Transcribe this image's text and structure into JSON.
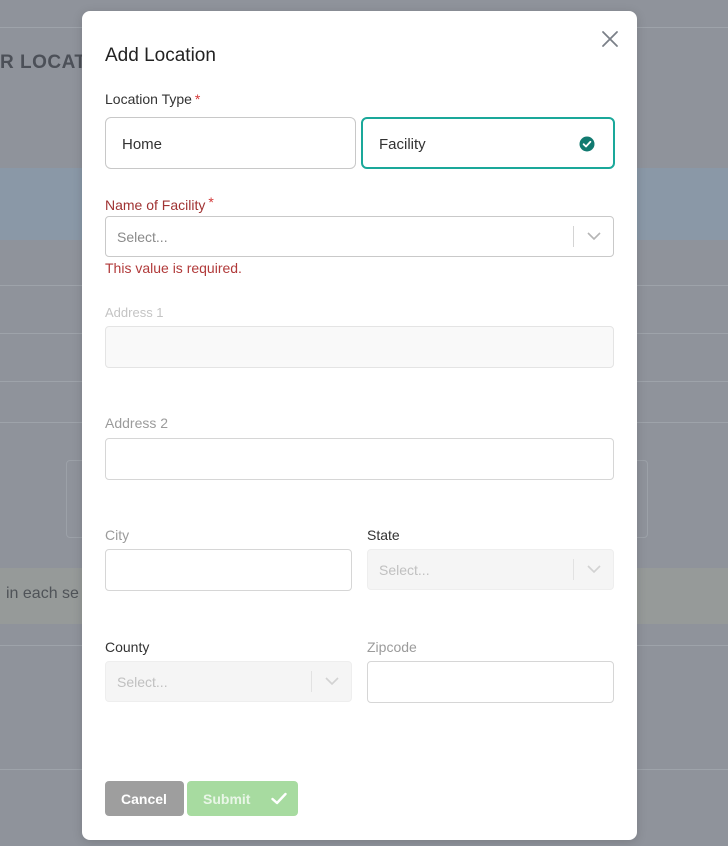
{
  "background": {
    "heading_fragment": "R LOCATIO",
    "banner_fragment": "in each se"
  },
  "modal": {
    "title": "Add Location",
    "close_icon": "close-icon",
    "location_type": {
      "label": "Location Type",
      "required_mark": "*",
      "options": [
        {
          "label": "Home",
          "selected": false
        },
        {
          "label": "Facility",
          "selected": true
        }
      ]
    },
    "facility_name": {
      "label": "Name of Facility",
      "required_mark": "*",
      "placeholder": "Select...",
      "error": "This value is required."
    },
    "address1": {
      "label": "Address 1",
      "value": ""
    },
    "address2": {
      "label": "Address 2",
      "value": ""
    },
    "city": {
      "label": "City",
      "value": ""
    },
    "state": {
      "label": "State",
      "placeholder": "Select..."
    },
    "county": {
      "label": "County",
      "placeholder": "Select..."
    },
    "zipcode": {
      "label": "Zipcode",
      "value": ""
    },
    "buttons": {
      "cancel": "Cancel",
      "submit": "Submit"
    }
  },
  "colors": {
    "accent": "#1aa89a",
    "error": "#a03333",
    "submit_disabled": "#a7dba0",
    "cancel": "#9e9e9e"
  }
}
